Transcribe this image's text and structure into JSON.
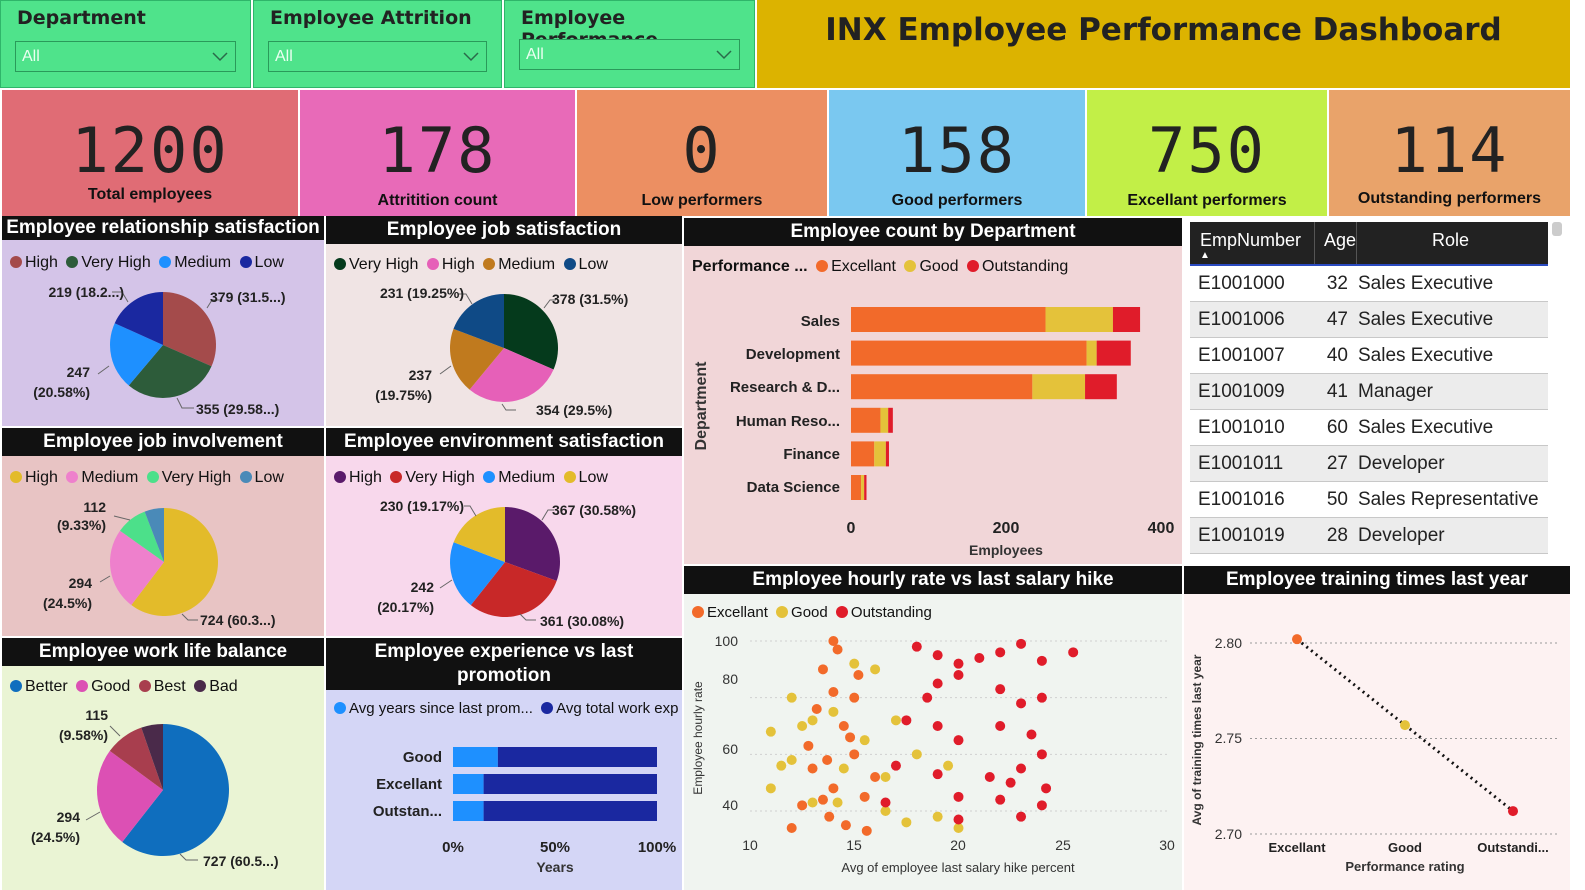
{
  "dashboard_title": "INX Employee Performance Dashboard",
  "slicers": [
    {
      "title": "Department",
      "value": "All"
    },
    {
      "title": "Employee Attrition",
      "value": "All"
    },
    {
      "title": "Employee Performance",
      "value": "All"
    }
  ],
  "kpis": [
    {
      "value": "1200",
      "label": "Total employees",
      "color": "#e06c75"
    },
    {
      "value": "178",
      "label": "Attritition count",
      "color": "#e86ab8"
    },
    {
      "value": "0",
      "label": "Low performers",
      "color": "#ec8f62"
    },
    {
      "value": "158",
      "label": "Good performers",
      "color": "#7ac8f0"
    },
    {
      "value": "750",
      "label": "Excellant performers",
      "color": "#c2ef47"
    },
    {
      "value": "114",
      "label": "Outstanding performers",
      "color": "#e9a36a"
    }
  ],
  "pies": {
    "relationship": {
      "title": "Employee relationship satisfaction",
      "legend": [
        {
          "name": "High",
          "color": "#a44b4b"
        },
        {
          "name": "Very High",
          "color": "#2d5c3a"
        },
        {
          "name": "Medium",
          "color": "#1e90ff"
        },
        {
          "name": "Low",
          "color": "#1a28a0"
        }
      ],
      "labels": [
        "379 (31.5...)",
        "355 (29.58...)",
        "247",
        "(20.58%)",
        "219 (18.2...)"
      ]
    },
    "job_satisfaction": {
      "title": "Employee job satisfaction",
      "legend": [
        {
          "name": "Very High",
          "color": "#053a1c"
        },
        {
          "name": "High",
          "color": "#e660b8"
        },
        {
          "name": "Medium",
          "color": "#c07a1e"
        },
        {
          "name": "Low",
          "color": "#0f4a86"
        }
      ],
      "labels": [
        "378 (31.5%)",
        "354 (29.5%)",
        "237",
        "(19.75%)",
        "231 (19.25%)"
      ]
    },
    "involvement": {
      "title": "Employee job involvement",
      "legend": [
        {
          "name": "High",
          "color": "#e3bb2a"
        },
        {
          "name": "Medium",
          "color": "#ee80cc"
        },
        {
          "name": "Very High",
          "color": "#4ce08a"
        },
        {
          "name": "Low",
          "color": "#4a8ab8"
        }
      ],
      "labels": [
        "724 (60.3...)",
        "294",
        "(24.5%)",
        "112",
        "(9.33%)"
      ]
    },
    "environment": {
      "title": "Employee environment satisfaction",
      "legend": [
        {
          "name": "High",
          "color": "#5a1a6a"
        },
        {
          "name": "Very High",
          "color": "#c82828"
        },
        {
          "name": "Medium",
          "color": "#1e90ff"
        },
        {
          "name": "Low",
          "color": "#e3bb2a"
        }
      ],
      "labels": [
        "367 (30.58%)",
        "361 (30.08%)",
        "242",
        "(20.17%)",
        "230 (19.17%)"
      ]
    },
    "worklife": {
      "title": "Employee work life balance",
      "legend": [
        {
          "name": "Better",
          "color": "#0f6ebe"
        },
        {
          "name": "Good",
          "color": "#dc50b4"
        },
        {
          "name": "Best",
          "color": "#a83e4e"
        },
        {
          "name": "Bad",
          "color": "#4a2a4a"
        }
      ],
      "labels": [
        "727 (60.5...)",
        "294",
        "(24.5%)",
        "115",
        "(9.58%)"
      ]
    }
  },
  "dept_chart": {
    "title": "Employee count by Department",
    "legend_title": "Performance ...",
    "legend": [
      {
        "name": "Excellant",
        "color": "#f26a2a"
      },
      {
        "name": "Good",
        "color": "#e4c23a"
      },
      {
        "name": "Outstanding",
        "color": "#e01c2a"
      }
    ],
    "ylabel": "Department",
    "xlabel": "Employees",
    "ticks": [
      "0",
      "200",
      "400"
    ]
  },
  "experience_chart": {
    "title_line1": "Employee experience vs last",
    "title_line2": "promotion",
    "legend": [
      {
        "name": "Avg years since last prom...",
        "color": "#1e90ff"
      },
      {
        "name": "Avg total work exp",
        "color": "#1a28a0"
      }
    ],
    "xlabel": "Years",
    "ticks": [
      "0%",
      "50%",
      "100%"
    ]
  },
  "scatter_chart": {
    "title": "Employee hourly rate vs last salary hike",
    "legend": [
      {
        "name": "Excellant",
        "color": "#f26a2a"
      },
      {
        "name": "Good",
        "color": "#e4c23a"
      },
      {
        "name": "Outstanding",
        "color": "#e01c2a"
      }
    ],
    "xlabel": "Avg of employee last salary hike percent",
    "ylabel": "Employee hourly rate",
    "xticks": [
      "10",
      "15",
      "20",
      "25",
      "30"
    ],
    "yticks": [
      "100",
      "80",
      "60",
      "40"
    ]
  },
  "training_chart": {
    "title": "Employee training times last year",
    "xlabel": "Performance rating",
    "ylabel": "Avg of training times last year",
    "yticks": [
      "2.80",
      "2.75",
      "2.70"
    ]
  },
  "table": {
    "headers": [
      "EmpNumber",
      "Age",
      "Role"
    ],
    "rows": [
      {
        "emp": "E1001000",
        "age": "32",
        "role": "Sales Executive"
      },
      {
        "emp": "E1001006",
        "age": "47",
        "role": "Sales Executive"
      },
      {
        "emp": "E1001007",
        "age": "40",
        "role": "Sales Executive"
      },
      {
        "emp": "E1001009",
        "age": "41",
        "role": "Manager"
      },
      {
        "emp": "E1001010",
        "age": "60",
        "role": "Sales Executive"
      },
      {
        "emp": "E1001011",
        "age": "27",
        "role": "Developer"
      },
      {
        "emp": "E1001016",
        "age": "50",
        "role": "Sales Representative"
      },
      {
        "emp": "E1001019",
        "age": "28",
        "role": "Developer"
      }
    ]
  },
  "chart_data": [
    {
      "type": "pie",
      "title": "Employee relationship satisfaction",
      "categories": [
        "High",
        "Very High",
        "Medium",
        "Low"
      ],
      "values": [
        379,
        355,
        247,
        219
      ]
    },
    {
      "type": "pie",
      "title": "Employee job satisfaction",
      "categories": [
        "Very High",
        "High",
        "Medium",
        "Low"
      ],
      "values": [
        378,
        354,
        237,
        231
      ]
    },
    {
      "type": "pie",
      "title": "Employee job involvement",
      "categories": [
        "High",
        "Medium",
        "Very High",
        "Low"
      ],
      "values": [
        724,
        294,
        112,
        70
      ]
    },
    {
      "type": "pie",
      "title": "Employee environment satisfaction",
      "categories": [
        "High",
        "Very High",
        "Medium",
        "Low"
      ],
      "values": [
        367,
        361,
        242,
        230
      ]
    },
    {
      "type": "pie",
      "title": "Employee work life balance",
      "categories": [
        "Better",
        "Good",
        "Best",
        "Bad"
      ],
      "values": [
        727,
        294,
        115,
        64
      ]
    },
    {
      "type": "bar",
      "title": "Employee count by Department",
      "orientation": "horizontal",
      "stacked": true,
      "categories": [
        "Sales",
        "Development",
        "Research & D...",
        "Human Reso...",
        "Finance",
        "Data Science"
      ],
      "series": [
        {
          "name": "Excellant",
          "values": [
            251,
            304,
            234,
            38,
            30,
            13
          ]
        },
        {
          "name": "Good",
          "values": [
            87,
            13,
            68,
            10,
            15,
            4
          ]
        },
        {
          "name": "Outstanding",
          "values": [
            35,
            44,
            41,
            6,
            4,
            3
          ]
        }
      ],
      "xlabel": "Employees",
      "ylabel": "Department",
      "xlim": [
        0,
        400
      ]
    },
    {
      "type": "bar",
      "title": "Employee experience vs last promotion",
      "orientation": "horizontal",
      "stacked": true,
      "percent": true,
      "categories": [
        "Good",
        "Excellant",
        "Outstan..."
      ],
      "series": [
        {
          "name": "Avg years since last prom...",
          "values": [
            22,
            15,
            15
          ]
        },
        {
          "name": "Avg total work exp",
          "values": [
            78,
            85,
            85
          ]
        }
      ],
      "xlabel": "Years",
      "xlim": [
        0,
        100
      ]
    },
    {
      "type": "scatter",
      "title": "Employee hourly rate vs last salary hike",
      "xlabel": "Avg of employee last salary hike percent",
      "ylabel": "Employee hourly rate",
      "xlim": [
        10,
        30
      ],
      "ylim": [
        30,
        100
      ],
      "series": [
        {
          "name": "Excellant",
          "points": [
            [
              13.5,
              90
            ],
            [
              14,
              82
            ],
            [
              14.5,
              70
            ],
            [
              15,
              60
            ],
            [
              13,
              55
            ],
            [
              14,
              48
            ],
            [
              15.5,
              45
            ],
            [
              12.5,
              42
            ],
            [
              13.8,
              38
            ],
            [
              14.2,
              97
            ],
            [
              15.2,
              88
            ],
            [
              13.2,
              76
            ],
            [
              14.8,
              66
            ],
            [
              12.8,
              63
            ],
            [
              16,
              52
            ],
            [
              13.5,
              44
            ],
            [
              14.6,
              35
            ],
            [
              15.6,
              33
            ],
            [
              12,
              34
            ],
            [
              14,
              100
            ],
            [
              13.7,
              58
            ],
            [
              15,
              80
            ]
          ]
        },
        {
          "name": "Good",
          "points": [
            [
              11,
              68
            ],
            [
              12,
              58
            ],
            [
              11.5,
              56
            ],
            [
              13,
              72
            ],
            [
              14,
              75
            ],
            [
              15,
              92
            ],
            [
              16,
              90
            ],
            [
              17,
              72
            ],
            [
              12,
              80
            ],
            [
              14.5,
              55
            ],
            [
              13,
              43
            ],
            [
              16.5,
              40
            ],
            [
              17.5,
              36
            ],
            [
              19,
              38
            ],
            [
              20,
              34
            ],
            [
              19.5,
              56
            ],
            [
              18,
              60
            ],
            [
              11,
              48
            ],
            [
              15.5,
              65
            ],
            [
              16.5,
              52
            ],
            [
              14.2,
              43
            ],
            [
              12.5,
              70
            ]
          ]
        },
        {
          "name": "Outstanding",
          "points": [
            [
              18,
              98
            ],
            [
              19,
              95
            ],
            [
              20,
              92
            ],
            [
              21,
              94
            ],
            [
              22,
              96
            ],
            [
              23,
              99
            ],
            [
              24,
              93
            ],
            [
              25.5,
              96
            ],
            [
              19,
              85
            ],
            [
              20,
              88
            ],
            [
              22,
              83
            ],
            [
              23,
              78
            ],
            [
              24,
              80
            ],
            [
              19,
              70
            ],
            [
              20,
              65
            ],
            [
              22,
              70
            ],
            [
              23,
              55
            ],
            [
              24,
              60
            ],
            [
              19,
              53
            ],
            [
              20,
              45
            ],
            [
              22,
              44
            ],
            [
              23,
              38
            ],
            [
              24,
              42
            ],
            [
              17.5,
              72
            ],
            [
              17,
              56
            ],
            [
              16.5,
              43
            ],
            [
              20,
              37
            ],
            [
              22.5,
              50
            ],
            [
              23.5,
              67
            ],
            [
              21.5,
              52
            ],
            [
              18.5,
              80
            ],
            [
              24.2,
              48
            ]
          ]
        }
      ]
    },
    {
      "type": "line",
      "title": "Employee training times last year",
      "categories": [
        "Excellant",
        "Good",
        "Outstandi..."
      ],
      "values": [
        2.802,
        2.757,
        2.712
      ],
      "xlabel": "Performance rating",
      "ylabel": "Avg of training times last year",
      "ylim": [
        2.7,
        2.8
      ]
    }
  ]
}
